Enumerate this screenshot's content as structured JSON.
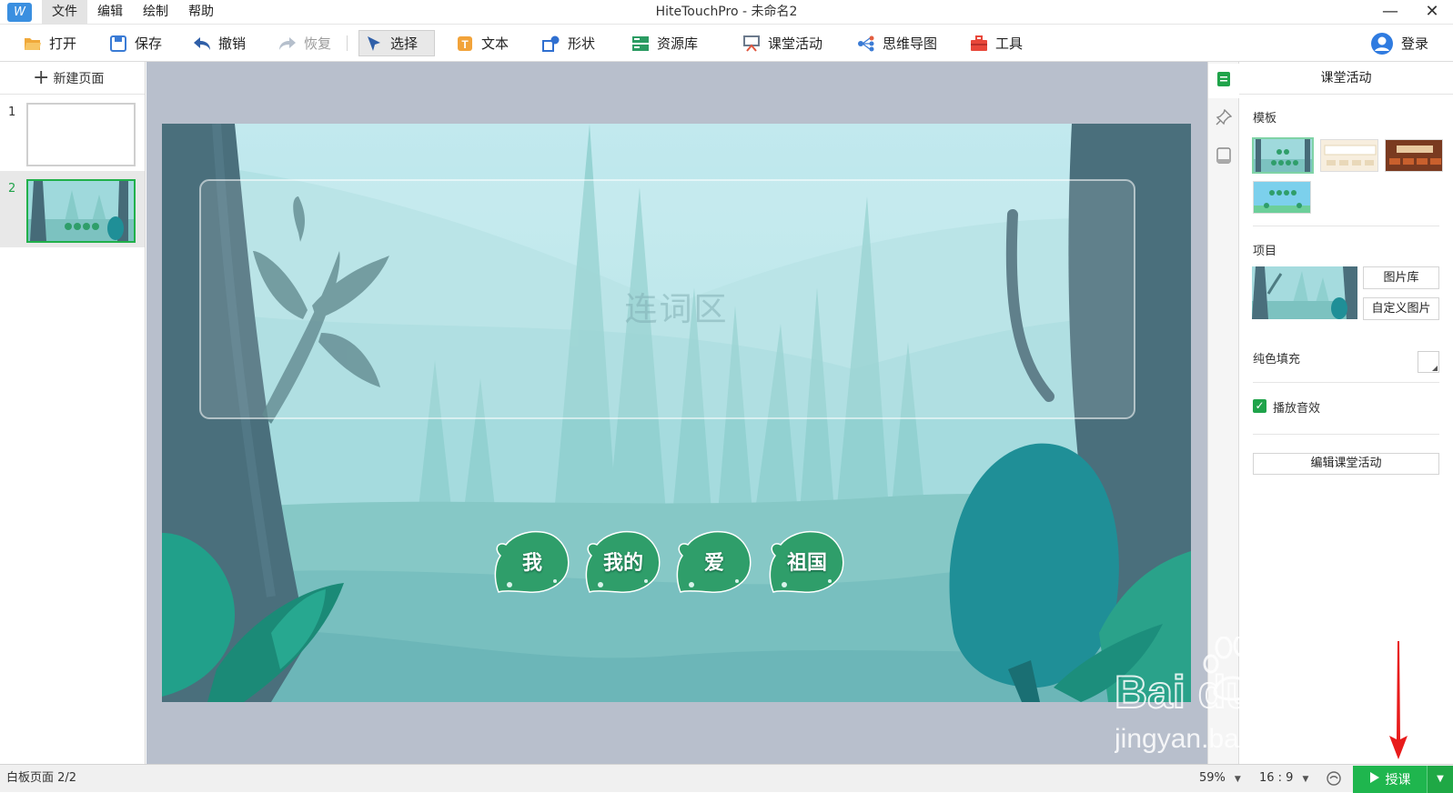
{
  "app": {
    "window_title": "HiteTouchPro - 未命名2",
    "menu": [
      "文件",
      "编辑",
      "绘制",
      "帮助"
    ],
    "minimize": "—",
    "close": "✕"
  },
  "toolbar": {
    "open": "打开",
    "save": "保存",
    "undo": "撤销",
    "redo": "恢复",
    "select": "选择",
    "text": "文本",
    "shape": "形状",
    "resources": "资源库",
    "class_activity": "课堂活动",
    "mind_map": "思维导图",
    "tools": "工具",
    "login": "登录"
  },
  "pages": {
    "new_page": "新建页面",
    "items": [
      {
        "num": "1"
      },
      {
        "num": "2"
      }
    ]
  },
  "slide": {
    "link_zone": "连词区",
    "words": [
      "我",
      "我的",
      "爱",
      "祖国"
    ]
  },
  "panel": {
    "title": "课堂活动",
    "template_label": "模板",
    "item_label": "项目",
    "image_library": "图片库",
    "custom_image": "自定义图片",
    "solid_fill": "纯色填充",
    "play_sound": "播放音效",
    "edit_activity": "编辑课堂活动"
  },
  "status": {
    "page_info": "白板页面 2/2",
    "zoom": "59%",
    "ratio": "16 : 9",
    "present": "授课"
  },
  "watermark": {
    "brand": "Bai du 经验",
    "url": "jingyan.baidu.com"
  },
  "colors": {
    "accent_green": "#1fb64e",
    "canvas_bg": "#b8bfcc",
    "leaf_green": "#2f9e6a"
  }
}
